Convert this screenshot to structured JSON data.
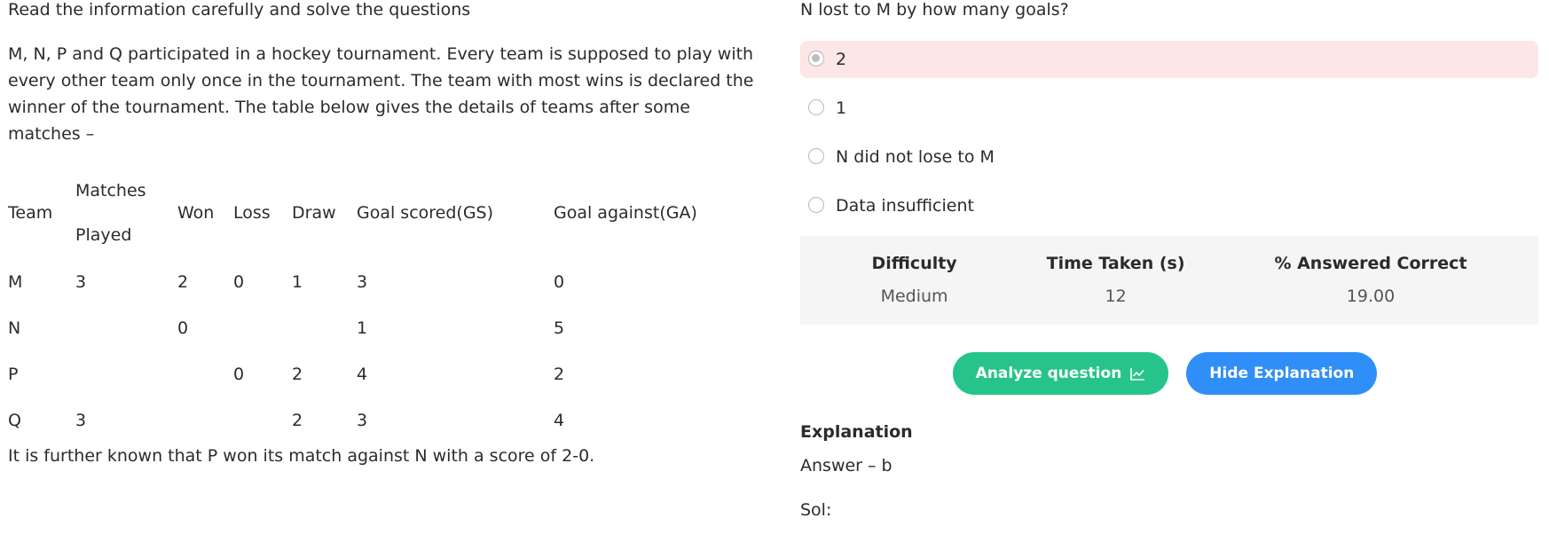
{
  "left": {
    "instruction": "Read the information carefully and solve the questions",
    "paragraph": "M, N, P and Q participated in a hockey tournament. Every team is supposed to play with every other team only once in the tournament. The team with most wins is declared the winner of the tournament. The table below gives the details of teams after some matches –",
    "table": {
      "headers": {
        "team": "Team",
        "matches_line1": "Matches",
        "matches_line2": "Played",
        "won": "Won",
        "loss": "Loss",
        "draw": "Draw",
        "gs": "Goal scored(GS)",
        "ga": "Goal against(GA)"
      },
      "rows": [
        {
          "team": "M",
          "played": "3",
          "won": "2",
          "loss": "0",
          "draw": "1",
          "gs": "3",
          "ga": "0"
        },
        {
          "team": "N",
          "played": "",
          "won": "0",
          "loss": "",
          "draw": "",
          "gs": "1",
          "ga": "5"
        },
        {
          "team": "P",
          "played": "",
          "won": "",
          "loss": "0",
          "draw": "2",
          "gs": "4",
          "ga": "2"
        },
        {
          "team": "Q",
          "played": "3",
          "won": "",
          "loss": "",
          "draw": "2",
          "gs": "3",
          "ga": "4"
        }
      ]
    },
    "footnote": "It is further known that P won its match against N with a score of 2-0."
  },
  "right": {
    "question": "N lost to M by how many goals?",
    "options": [
      {
        "label": "2",
        "selected": true
      },
      {
        "label": "1",
        "selected": false
      },
      {
        "label": "N did not lose to M",
        "selected": false
      },
      {
        "label": "Data insufficient",
        "selected": false
      }
    ],
    "stats": {
      "difficulty_label": "Difficulty",
      "difficulty_value": "Medium",
      "time_label": "Time Taken (s)",
      "time_value": "12",
      "correct_label": "% Answered Correct",
      "correct_value": "19.00"
    },
    "buttons": {
      "analyze": "Analyze question",
      "hide": "Hide Explanation"
    },
    "explanation": {
      "title": "Explanation",
      "answer": "Answer – b",
      "sol": "Sol:"
    }
  },
  "colors": {
    "selected_bg": "#fde6e6",
    "stats_bg": "#f5f5f5",
    "green": "#26c48a",
    "blue": "#2f8ef7"
  },
  "icons": {
    "analyze": "chart-line-icon"
  }
}
